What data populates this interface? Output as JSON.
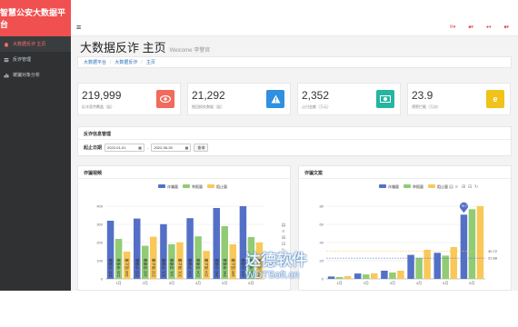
{
  "brand": "智慧公安大数据平台",
  "sidebar": {
    "items": [
      {
        "label": "大数据反诈 主页",
        "icon": "home-icon"
      },
      {
        "label": "反诈管理",
        "icon": "list-icon"
      },
      {
        "label": "被骗对象分析",
        "icon": "chart-icon"
      }
    ]
  },
  "topbar": {
    "menu_icon": "≡",
    "icons": [
      "mail-icon",
      "bell-icon",
      "user-icon",
      "settings-icon"
    ]
  },
  "page": {
    "title": "大数据反诈 主页",
    "subtitle": "Welcome 李警官"
  },
  "breadcrumb": [
    "大数据平台",
    "大数据反诈",
    "主页"
  ],
  "stats": [
    {
      "value": "219,999",
      "label": "反诈宣传覆盖（起）",
      "icon": "eye-icon",
      "color": "#f06b5b"
    },
    {
      "value": "21,292",
      "label": "挽回损失数据（起）",
      "icon": "warning-icon",
      "color": "#2f8fe0"
    },
    {
      "value": "2,352",
      "label": "止付金额（万元）",
      "icon": "money-icon",
      "color": "#25b5a0"
    },
    {
      "value": "23.9",
      "label": "预警拦截（万次）",
      "icon": "ie-icon",
      "color": "#f0c21a"
    }
  ],
  "filter": {
    "title": "反诈信息管理",
    "label": "起止日期",
    "start": "2022-01-01",
    "end": "2022-06-30",
    "button": "查询"
  },
  "chart_data": [
    {
      "type": "bar",
      "title": "诈骗视频",
      "categories": [
        "1月",
        "2月",
        "3月",
        "4月",
        "5月",
        "6月"
      ],
      "series": [
        {
          "name": "诈骗量",
          "color": "#5470c6",
          "values": [
            320,
            332,
            301,
            334,
            390,
            400
          ]
        },
        {
          "name": "举报量",
          "color": "#91cc75",
          "values": [
            220,
            182,
            191,
            234,
            290,
            230
          ]
        },
        {
          "name": "阻止量",
          "color": "#fac858",
          "values": [
            150,
            232,
            201,
            154,
            190,
            200
          ]
        }
      ],
      "ylim": [
        0,
        400
      ],
      "yticks": [
        0,
        100,
        200,
        300,
        400
      ]
    },
    {
      "type": "bar",
      "title": "诈骗文案",
      "categories": [
        "1月",
        "2月",
        "3月",
        "4月",
        "5月",
        "6月"
      ],
      "series": [
        {
          "name": "诈骗量",
          "color": "#5470c6",
          "values": [
            2.6,
            5.9,
            9.0,
            26.4,
            28.7,
            70.7
          ]
        },
        {
          "name": "举报量",
          "color": "#91cc75",
          "values": [
            2.0,
            4.9,
            7.0,
            23.2,
            25.6,
            76.7
          ]
        },
        {
          "name": "阻止量",
          "color": "#fac858",
          "values": [
            3.0,
            6.0,
            9.0,
            32.0,
            35.0,
            80.0
          ]
        }
      ],
      "ylim": [
        0,
        80
      ],
      "yticks": [
        0,
        20,
        40,
        60,
        80
      ],
      "markpoint": "76.7",
      "marklines": [
        "30.72",
        "22.88"
      ]
    }
  ],
  "watermark": {
    "line1": "达德软件",
    "line2": "WDTSoft.cn"
  }
}
